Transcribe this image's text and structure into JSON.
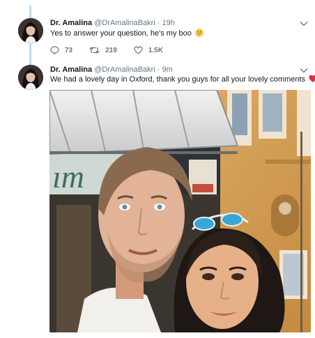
{
  "tweets": [
    {
      "name": "Dr. Amalina",
      "handle": "@DrAmalinaBakri",
      "separator": "·",
      "time": "19h",
      "text": "Yes to answer your question, he's my boo",
      "emoji": "grinning-emoji",
      "replies": "73",
      "retweets": "219",
      "likes": "1.5K"
    },
    {
      "name": "Dr. Amalina",
      "handle": "@DrAmalinaBakri",
      "separator": "·",
      "time": "9m",
      "text": "We had a lovely day in Oxford, thank you guys for all your lovely comments",
      "emoji": "red-heart-emoji"
    }
  ],
  "colors": {
    "thread_line": "#c4d7e4",
    "secondary_text": "#657786",
    "heart": "#e0245e"
  }
}
